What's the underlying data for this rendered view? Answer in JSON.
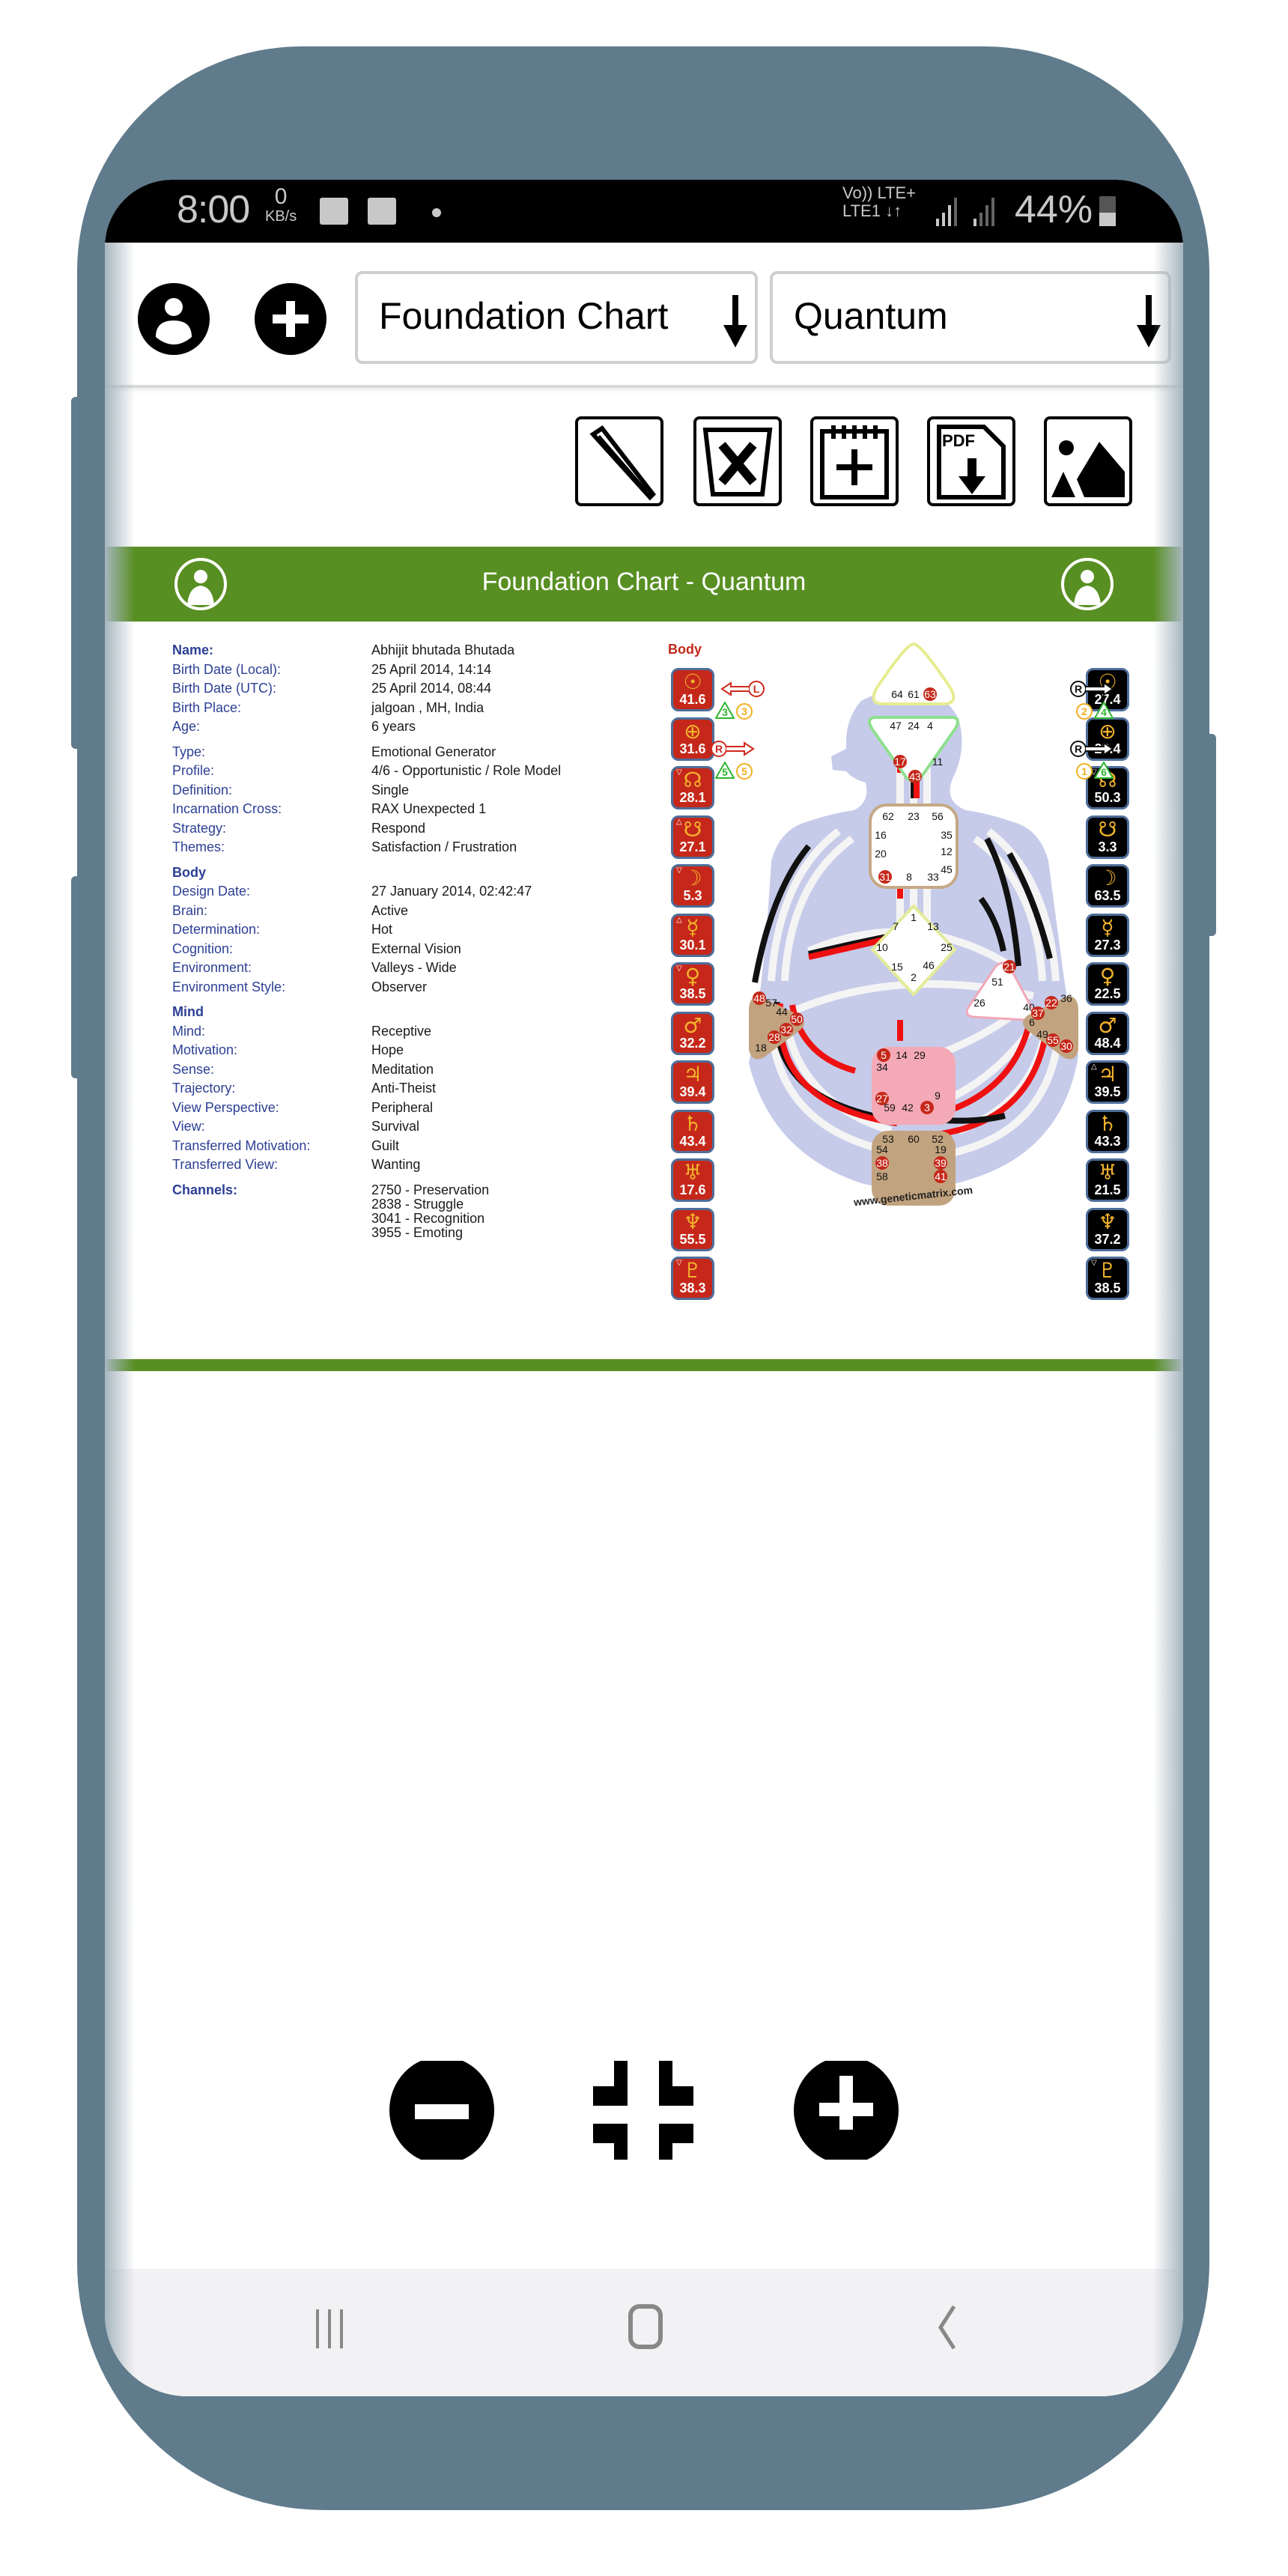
{
  "status_bar": {
    "time": "8:00",
    "speed_value": "0",
    "speed_unit": "KB/s",
    "notification_icons": [
      "gallery-icon",
      "email-icon",
      "dot-icon"
    ],
    "network_line1": "Vo)) LTE+",
    "network_line2": "LTE1 ↓↑",
    "battery_percent": "44%"
  },
  "top_bar": {
    "profile_icon": "user-icon",
    "add_icon": "plus-icon",
    "chart_type_select": {
      "value": "Foundation Chart"
    },
    "chart_mode_select": {
      "value": "Quantum"
    }
  },
  "toolbar": {
    "buttons": [
      {
        "name": "edit",
        "icon": "pencil-icon"
      },
      {
        "name": "delete",
        "icon": "trash-x-icon"
      },
      {
        "name": "new",
        "icon": "notepad-plus-icon"
      },
      {
        "name": "pdf",
        "icon": "pdf-download-icon",
        "label": "PDF"
      },
      {
        "name": "image",
        "icon": "image-icon"
      }
    ]
  },
  "chart_header": {
    "title": "Foundation Chart - Quantum"
  },
  "info": {
    "general": [
      {
        "k": "Name:",
        "v": "Abhijit bhutada Bhutada",
        "bold": true
      },
      {
        "k": "Birth Date (Local):",
        "v": "25 April 2014, 14:14"
      },
      {
        "k": "Birth Date (UTC):",
        "v": "25 April 2014, 08:44"
      },
      {
        "k": "Birth Place:",
        "v": "jalgoan , MH, India"
      },
      {
        "k": "Age:",
        "v": "6 years"
      }
    ],
    "design": [
      {
        "k": "Type:",
        "v": "Emotional Generator"
      },
      {
        "k": "Profile:",
        "v": "4/6 - Opportunistic / Role Model"
      },
      {
        "k": "Definition:",
        "v": "Single"
      },
      {
        "k": "Incarnation Cross:",
        "v": "RAX Unexpected 1"
      },
      {
        "k": "Strategy:",
        "v": "Respond"
      },
      {
        "k": "Themes:",
        "v": "Satisfaction / Frustration"
      }
    ],
    "body_heading": "Body",
    "body": [
      {
        "k": "Design Date:",
        "v": "27 January 2014, 02:42:47"
      },
      {
        "k": "Brain:",
        "v": "Active"
      },
      {
        "k": "Determination:",
        "v": "Hot"
      },
      {
        "k": "Cognition:",
        "v": "External Vision"
      },
      {
        "k": "Environment:",
        "v": "Valleys - Wide"
      },
      {
        "k": "Environment Style:",
        "v": "Observer"
      }
    ],
    "mind_heading": "Mind",
    "mind": [
      {
        "k": "Mind:",
        "v": "Receptive"
      },
      {
        "k": "Motivation:",
        "v": "Hope"
      },
      {
        "k": "Sense:",
        "v": "Meditation"
      },
      {
        "k": "Trajectory:",
        "v": "Anti-Theist"
      },
      {
        "k": "View Perspective:",
        "v": "Peripheral"
      },
      {
        "k": "View:",
        "v": "Survival"
      },
      {
        "k": "Transferred Motivation:",
        "v": "Guilt"
      },
      {
        "k": "Transferred View:",
        "v": "Wanting"
      }
    ],
    "channels_label": "Channels:",
    "channels": [
      "2750 - Preservation",
      "2838 - Struggle",
      "3041 - Recognition",
      "3955 - Emoting"
    ]
  },
  "bodygraph": {
    "design_label": "Body",
    "design_planets": [
      {
        "sym": "☉",
        "val": "41.6",
        "mark": ""
      },
      {
        "sym": "⊕",
        "val": "31.6",
        "mark": ""
      },
      {
        "sym": "☊",
        "val": "28.1",
        "mark": "▽"
      },
      {
        "sym": "☋",
        "val": "27.1",
        "mark": "△"
      },
      {
        "sym": "☽",
        "val": "5.3",
        "mark": "▽"
      },
      {
        "sym": "☿",
        "val": "30.1",
        "mark": "△"
      },
      {
        "sym": "♀",
        "val": "38.5",
        "mark": "▽"
      },
      {
        "sym": "♂",
        "val": "32.2",
        "mark": ""
      },
      {
        "sym": "♃",
        "val": "39.4",
        "mark": ""
      },
      {
        "sym": "♄",
        "val": "43.4",
        "mark": ""
      },
      {
        "sym": "♅",
        "val": "17.6",
        "mark": ""
      },
      {
        "sym": "♆",
        "val": "55.5",
        "mark": ""
      },
      {
        "sym": "♇",
        "val": "38.3",
        "mark": "▽"
      }
    ],
    "personality_planets": [
      {
        "sym": "☉",
        "val": "27.4",
        "mark": ""
      },
      {
        "sym": "⊕",
        "val": "28.4",
        "mark": ""
      },
      {
        "sym": "☊",
        "val": "50.3",
        "mark": "▽"
      },
      {
        "sym": "☋",
        "val": "3.3",
        "mark": ""
      },
      {
        "sym": "☽",
        "val": "63.5",
        "mark": ""
      },
      {
        "sym": "☿",
        "val": "27.3",
        "mark": ""
      },
      {
        "sym": "♀",
        "val": "22.5",
        "mark": ""
      },
      {
        "sym": "♂",
        "val": "48.4",
        "mark": ""
      },
      {
        "sym": "♃",
        "val": "39.5",
        "mark": "△"
      },
      {
        "sym": "♄",
        "val": "43.3",
        "mark": ""
      },
      {
        "sym": "♅",
        "val": "21.5",
        "mark": ""
      },
      {
        "sym": "♆",
        "val": "37.2",
        "mark": ""
      },
      {
        "sym": "♇",
        "val": "38.5",
        "mark": "▽"
      }
    ],
    "left_arrows": [
      {
        "letter": "L",
        "dir": "left",
        "tri": "3",
        "circ": "3"
      },
      {
        "letter": "R",
        "dir": "right",
        "tri": "5",
        "circ": "5"
      }
    ],
    "right_arrows": [
      {
        "letter": "R",
        "dir": "right",
        "circ": "2",
        "tri": "4"
      },
      {
        "letter": "R",
        "dir": "right",
        "circ": "1",
        "tri": "6"
      }
    ],
    "centers": {
      "head": [
        "64",
        "61",
        "63"
      ],
      "ajna": [
        "47",
        "24",
        "4",
        "17",
        "11",
        "43"
      ],
      "throat": [
        "62",
        "23",
        "56",
        "16",
        "35",
        "20",
        "12",
        "45",
        "31",
        "8",
        "33"
      ],
      "g": [
        "1",
        "7",
        "13",
        "10",
        "25",
        "15",
        "46",
        "2"
      ],
      "ego": [
        "21",
        "51",
        "26",
        "40"
      ],
      "spleen": [
        "48",
        "57",
        "44",
        "50",
        "32",
        "28",
        "18"
      ],
      "sacral": [
        "5",
        "14",
        "29",
        "34",
        "27",
        "59",
        "42",
        "3",
        "9"
      ],
      "solar_plexus": [
        "36",
        "22",
        "37",
        "6",
        "49",
        "55",
        "30"
      ],
      "root": [
        "53",
        "60",
        "52",
        "54",
        "19",
        "38",
        "39",
        "58",
        "41"
      ]
    },
    "activated_gates": [
      "63",
      "17",
      "43",
      "31",
      "21",
      "48",
      "50",
      "32",
      "28",
      "5",
      "27",
      "3",
      "22",
      "37",
      "55",
      "30",
      "38",
      "39",
      "41"
    ],
    "watermark": "www.geneticmatrix.com"
  },
  "zoom_controls": {
    "zoom_out_icon": "minus-circle-icon",
    "fit_icon": "fit-screen-icon",
    "zoom_in_icon": "plus-circle-icon"
  },
  "nav_bar": {
    "recents_icon": "recents-icon",
    "home_icon": "home-icon",
    "back_icon": "back-icon"
  },
  "colors": {
    "accent_green": "#588f22",
    "label_blue": "#2c3f94",
    "design_red": "#c5281a",
    "personality_black": "#000000",
    "planet_gold": "#f2b32b",
    "frame": "#5f7b8c"
  }
}
